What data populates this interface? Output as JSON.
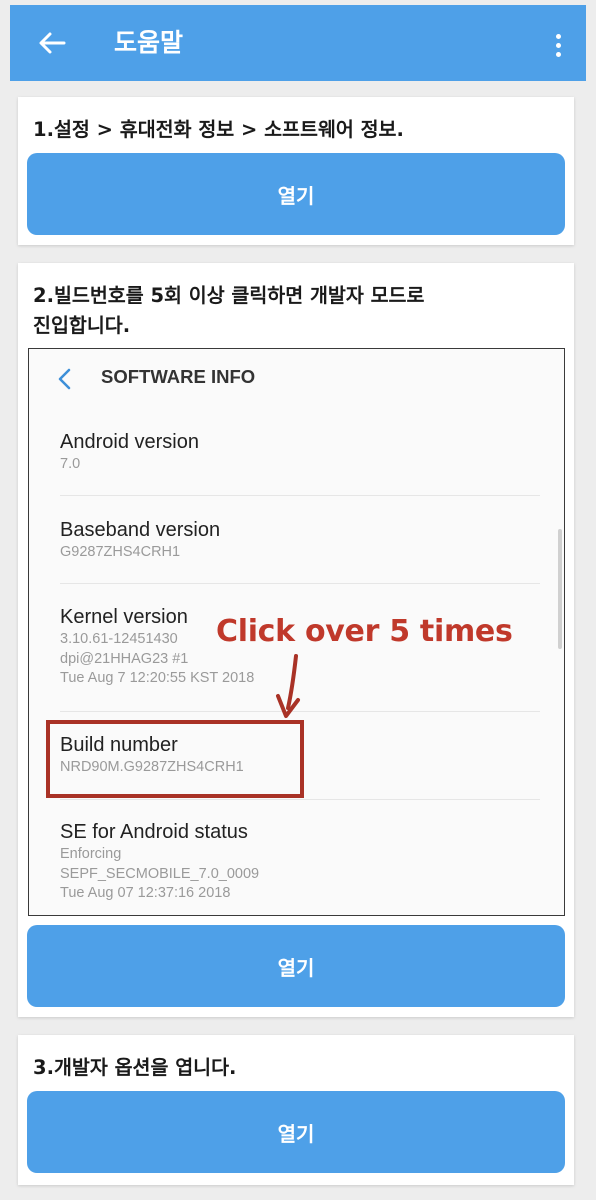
{
  "appbar": {
    "title": "도움말",
    "back_icon": "arrow-left-icon",
    "menu_icon": "more-vert-icon"
  },
  "steps": [
    {
      "text": "1.설정 > 휴대전화 정보 > 소프트웨어 정보.",
      "button": "열기"
    },
    {
      "text_line1": "2.빌드번호를 5회 이상 클릭하면 개발자 모드로",
      "text_line2": "진입합니다.",
      "button": "열기"
    },
    {
      "text": "3.개발자 옵션을 엽니다.",
      "button": "열기"
    }
  ],
  "software_info": {
    "title": "SOFTWARE INFO",
    "items": [
      {
        "title": "Android version",
        "lines": [
          "7.0"
        ]
      },
      {
        "title": "Baseband version",
        "lines": [
          "G9287ZHS4CRH1"
        ]
      },
      {
        "title": "Kernel version",
        "lines": [
          "3.10.61-12451430",
          "dpi@21HHAG23 #1",
          "Tue Aug 7 12:20:55 KST 2018"
        ]
      },
      {
        "title": "Build number",
        "lines": [
          "NRD90M.G9287ZHS4CRH1"
        ]
      },
      {
        "title": "SE for Android status",
        "lines": [
          "Enforcing",
          "SEPF_SECMOBILE_7.0_0009",
          "Tue Aug 07 12:37:16 2018"
        ]
      }
    ]
  },
  "annotation": {
    "text": "Click over 5 times",
    "color": "#c0392b"
  },
  "colors": {
    "accent": "#4ea0e8",
    "background": "#ededed"
  }
}
